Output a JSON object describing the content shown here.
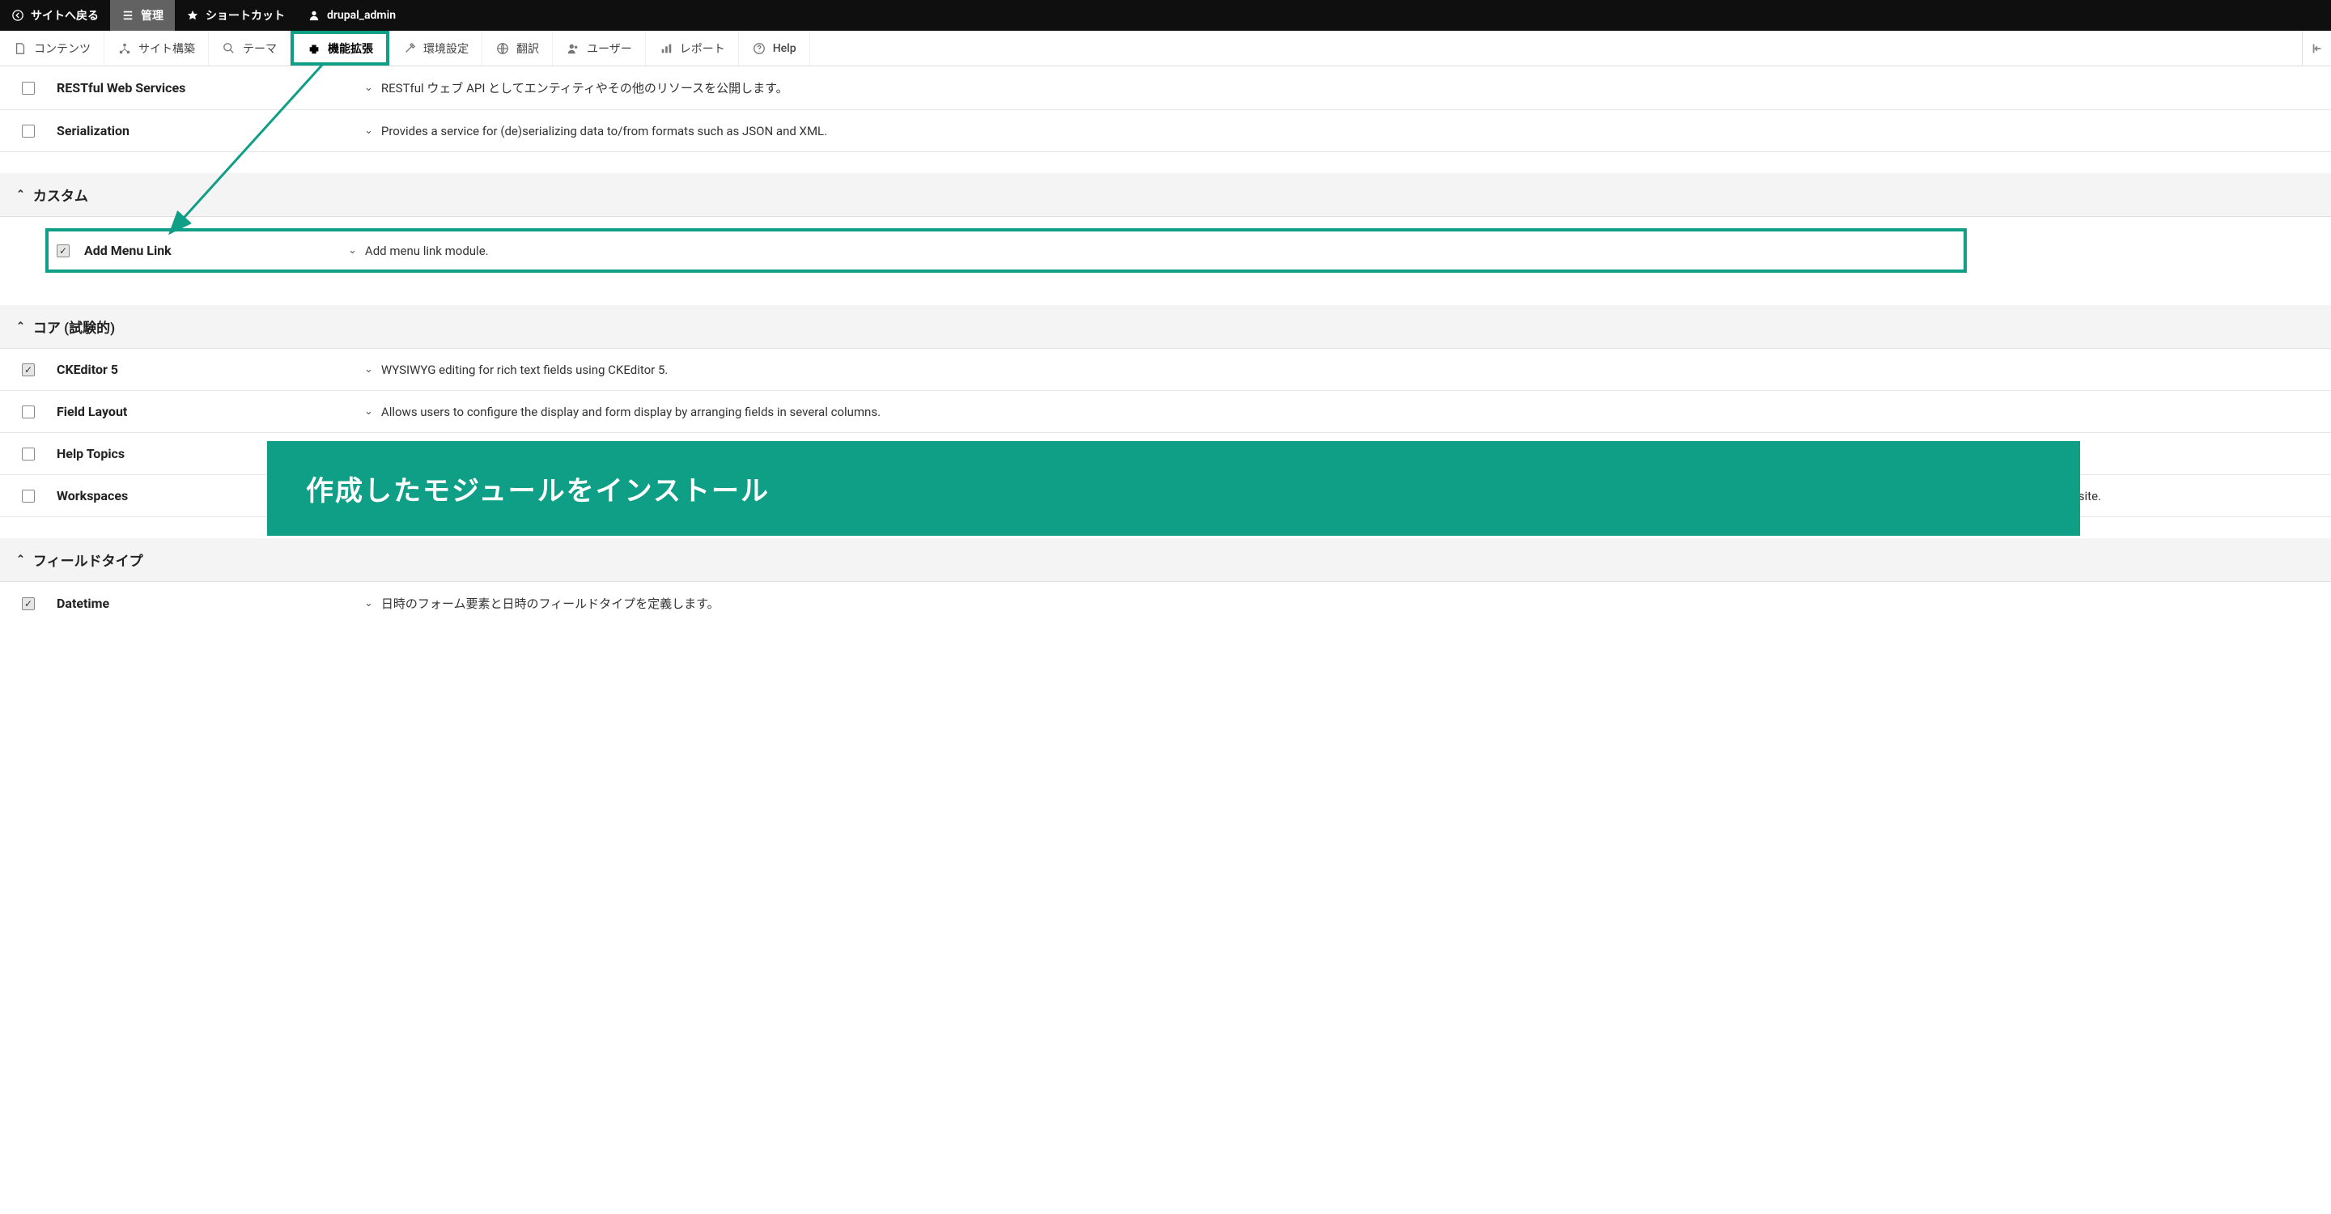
{
  "topbar": {
    "back": "サイトへ戻る",
    "manage": "管理",
    "shortcuts": "ショートカット",
    "user": "drupal_admin"
  },
  "tabs": {
    "content": "コンテンツ",
    "structure": "サイト構築",
    "appearance": "テーマ",
    "extend": "機能拡張",
    "config": "環境設定",
    "translate": "翻訳",
    "people": "ユーザー",
    "reports": "レポート",
    "help": "Help"
  },
  "sections": {
    "web_services_rows": [
      {
        "name": "RESTful Web Services",
        "desc": "RESTful ウェブ API としてエンティティやその他のリソースを公開します。",
        "checked": false
      },
      {
        "name": "Serialization",
        "desc": "Provides a service for (de)serializing data to/from formats such as JSON and XML.",
        "checked": false
      }
    ],
    "custom": {
      "title": "カスタム",
      "row": {
        "name": "Add Menu Link",
        "desc": "Add menu link module.",
        "checked": true
      }
    },
    "core_exp": {
      "title": "コア (試験的)",
      "rows": [
        {
          "name": "CKEditor 5",
          "desc": "WYSIWYG editing for rich text fields using CKEditor 5.",
          "checked": true
        },
        {
          "name": "Field Layout",
          "desc": "Allows users to configure the display and form display by arranging fields in several columns.",
          "checked": false
        },
        {
          "name": "Help Topics",
          "desc": "",
          "checked": false
        },
        {
          "name": "Workspaces",
          "desc": "gle site.",
          "checked": false
        }
      ]
    },
    "field_types": {
      "title": "フィールドタイプ",
      "rows": [
        {
          "name": "Datetime",
          "desc": "日時のフォーム要素と日時のフィールドタイプを定義します。",
          "checked": true
        }
      ]
    }
  },
  "banner": "作成したモジュールをインストール"
}
